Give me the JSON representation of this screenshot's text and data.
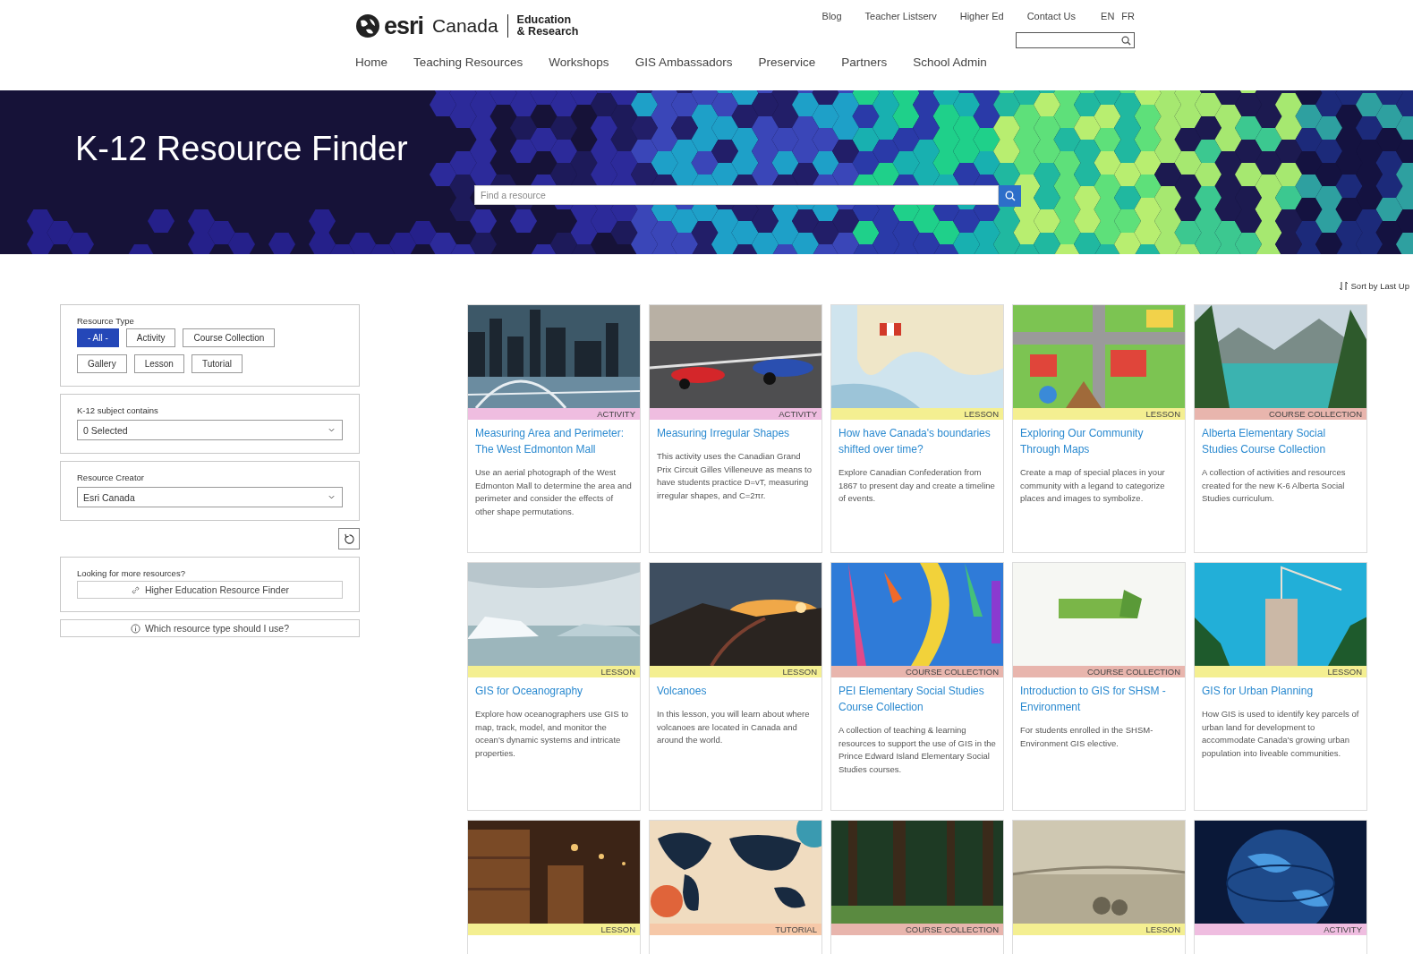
{
  "header": {
    "logo": {
      "brand": "esri",
      "region": "Canada",
      "line_1": "Education",
      "line_2": "& Research"
    },
    "top_links": [
      "Blog",
      "Teacher Listserv",
      "Higher Ed",
      "Contact Us"
    ],
    "languages": [
      "EN",
      "FR"
    ],
    "nav": [
      "Home",
      "Teaching Resources",
      "Workshops",
      "GIS Ambassadors",
      "Preservice",
      "Partners",
      "School Admin"
    ]
  },
  "banner": {
    "title": "K-12 Resource Finder",
    "search": {
      "placeholder": "Find a resource"
    }
  },
  "filters": {
    "resource_type": {
      "label": "Resource Type",
      "options": [
        {
          "label": "- All -",
          "selected": true
        },
        {
          "label": "Activity",
          "selected": false
        },
        {
          "label": "Course Collection",
          "selected": false
        },
        {
          "label": "Gallery",
          "selected": false
        },
        {
          "label": "Lesson",
          "selected": false
        },
        {
          "label": "Tutorial",
          "selected": false
        }
      ]
    },
    "subject": {
      "label": "K-12 subject contains",
      "value": "0 Selected"
    },
    "creator": {
      "label": "Resource Creator",
      "value": "Esri Canada"
    },
    "more": {
      "label": "Looking for more resources?",
      "link": "Higher Education Resource Finder"
    },
    "help": "Which resource type should I use?"
  },
  "sort": "Sort by Last Up",
  "cards": [
    {
      "tag": "ACTIVITY",
      "color": "#efbde0",
      "title": "Measuring Area and Perimeter: The West Edmonton Mall",
      "description": "Use an aerial photograph of the West Edmonton Mall to determine the area and perimeter and consider the effects of other shape permutations."
    },
    {
      "tag": "ACTIVITY",
      "color": "#efbde0",
      "title": "Measuring Irregular Shapes",
      "description": "This activity uses the Canadian Grand Prix Circuit Gilles Villeneuve as means to have students practice D=vT, measuring irregular shapes, and C=2πr."
    },
    {
      "tag": "LESSON",
      "color": "#f4ef91",
      "title": "How have Canada's boundaries shifted over time?",
      "description": "Explore Canadian Confederation from 1867 to present day and create a timeline of events."
    },
    {
      "tag": "LESSON",
      "color": "#f4ef91",
      "title": "Exploring Our Community Through Maps",
      "description": "Create a map of special places in your community with a legand to categorize places and images to symbolize."
    },
    {
      "tag": "COURSE COLLECTION",
      "color": "#e8b5ad",
      "title": "Alberta Elementary Social Studies Course Collection",
      "description": "A collection of activities and resources created for the new K-6 Alberta Social Studies curriculum."
    },
    {
      "tag": "LESSON",
      "color": "#f4ef91",
      "title": "GIS for Oceanography",
      "description": "Explore how oceanographers use GIS to map, track, model, and monitor the ocean's dynamic systems and intricate properties."
    },
    {
      "tag": "LESSON",
      "color": "#f4ef91",
      "title": "Volcanoes",
      "description": "In this lesson, you will learn about where volcanoes are located in Canada and around the world."
    },
    {
      "tag": "COURSE COLLECTION",
      "color": "#e8b5ad",
      "title": "PEI Elementary Social Studies Course Collection",
      "description": "A collection of teaching & learning resources to support the use of GIS in the Prince Edward Island Elementary Social Studies courses."
    },
    {
      "tag": "COURSE COLLECTION",
      "color": "#e8b5ad",
      "title": "Introduction to GIS for SHSM - Environment",
      "description": "For students enrolled in the SHSM-Environment GIS elective."
    },
    {
      "tag": "LESSON",
      "color": "#f4ef91",
      "title": "GIS for Urban Planning",
      "description": "How GIS is used to identify key parcels of urban land for development to accommodate Canada's growing urban population into liveable communities."
    },
    {
      "tag": "LESSON",
      "color": "#f4ef91"
    },
    {
      "tag": "TUTORIAL",
      "color": "#f6c8a8"
    },
    {
      "tag": "COURSE COLLECTION",
      "color": "#e8b5ad"
    },
    {
      "tag": "LESSON",
      "color": "#f4ef91"
    },
    {
      "tag": "ACTIVITY",
      "color": "#efbde0"
    }
  ]
}
